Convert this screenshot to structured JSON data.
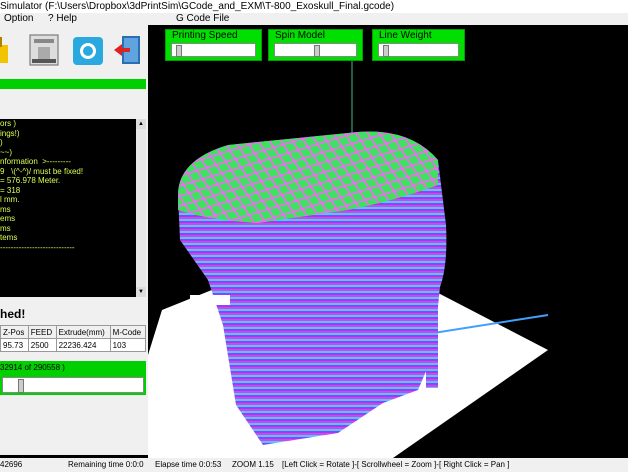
{
  "window": {
    "title": "Simulator  (F:\\Users\\Dropbox\\3dPrintSim\\GCode_and_EXM\\T-800_Exoskull_Final.gcode)"
  },
  "menu": {
    "option": "Option",
    "help": "Help",
    "gcode_file": "G Code File"
  },
  "toolbar": {
    "icons": [
      "printer-icon",
      "camera-icon",
      "exit-icon"
    ]
  },
  "log": {
    "lines": [
      "ors )",
      "ings!)",
      ")",
      "~~)",
      "",
      "nformation  >---------",
      "9   \\(^-^)/ must be fixed!",
      "= 576.978 Meter.",
      "= 318",
      "l mm.",
      "",
      "ms",
      "ems",
      "ms",
      "tems",
      "----------------------------"
    ]
  },
  "finished_label": "hed!",
  "table": {
    "headers": [
      "Z-Pos",
      "FEED",
      "Extrude(mm)",
      "M-Code"
    ],
    "row": [
      "95.73",
      "2500",
      "22236.424",
      "103"
    ]
  },
  "progress": {
    "text": "32914 of 290558 )",
    "fraction": 0.113
  },
  "controls": {
    "printing_speed": {
      "label": "Printing Speed",
      "level": 0.05
    },
    "spin_model": {
      "label": "Spin Model",
      "level": 0.52
    },
    "line_weight": {
      "label": "Line Weight",
      "level": 0.05
    }
  },
  "status": {
    "count": "42696",
    "remaining": "Remaining time  0:0:0",
    "elapse": "Elapse time  0:0:53",
    "zoom": "ZOOM 1.15",
    "hint": "[Left Click = Rotate ]-[ Scrollwheel = Zoom ]-[ Right Click = Pan ]"
  },
  "colors": {
    "accent_green": "#00d000",
    "log_text": "#d8ff50",
    "viewport_bg": "#000000",
    "platform": "#ffffff"
  }
}
